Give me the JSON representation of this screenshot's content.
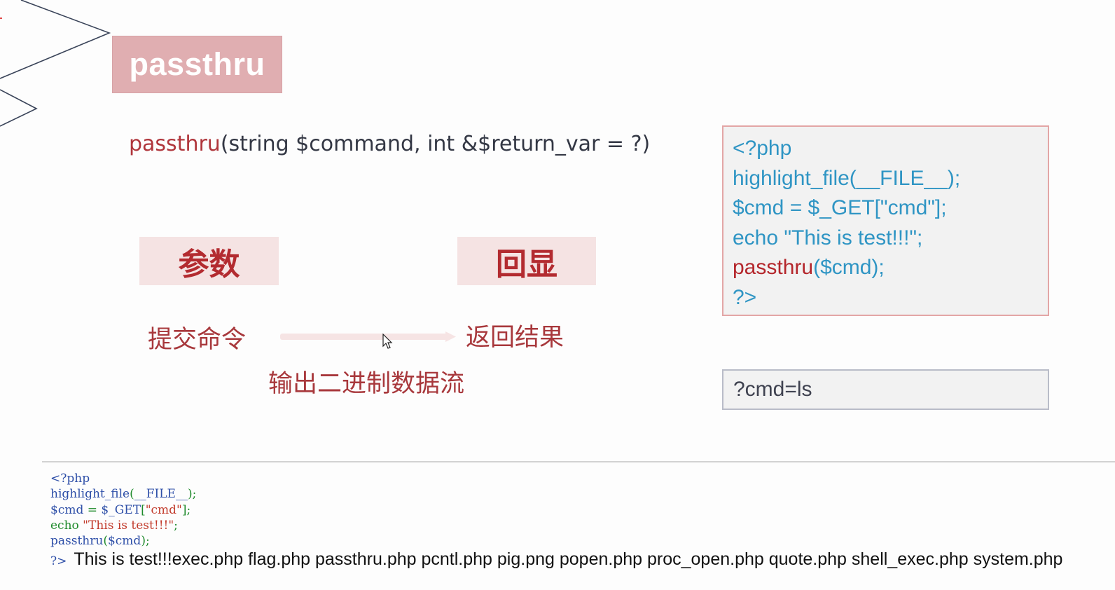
{
  "slide": {
    "title": "passthru",
    "signature": {
      "function_name": "passthru",
      "params": "(string $command, int &$return_var = ?)"
    },
    "label_params": "参数",
    "label_echo": "回显",
    "text_submit": "提交命令",
    "text_return": "返回结果",
    "text_stream": "输出二进制数据流"
  },
  "code_box": {
    "line1": "<?php",
    "line2": "highlight_file(__FILE__);",
    "line3": "$cmd = $_GET[\"cmd\"];",
    "line4": "echo \"This is test!!!\";",
    "line5_fn": "passthru",
    "line5_rest": "($cmd);",
    "line6": "?>"
  },
  "query_box": {
    "text": "?cmd=ls"
  },
  "output": {
    "l1": "<?php",
    "l2_fn": "highlight_file",
    "l2_a": "(",
    "l2_b": "__FILE__",
    "l2_c": ");",
    "l3_a": "$cmd",
    "l3_b": " = ",
    "l3_c": "$_GET",
    "l3_d": "[",
    "l3_e": "\"cmd\"",
    "l3_f": "];",
    "l4_a": "echo ",
    "l4_b": "\"This is test!!!\"",
    "l4_c": ";",
    "l5_a": "passthru",
    "l5_b": "(",
    "l5_c": "$cmd",
    "l5_d": ");",
    "tag": "?>",
    "result": "This is test!!!exec.php flag.php passthru.php pcntl.php pig.png popen.php proc_open.php quote.php shell_exec.php system.php"
  },
  "colors": {
    "accent_red": "#b32b30",
    "code_blue": "#2f95c4",
    "badge_pink": "#e0aeb1"
  },
  "icons": [
    "mouse-cursor-icon",
    "right-arrow-icon"
  ]
}
